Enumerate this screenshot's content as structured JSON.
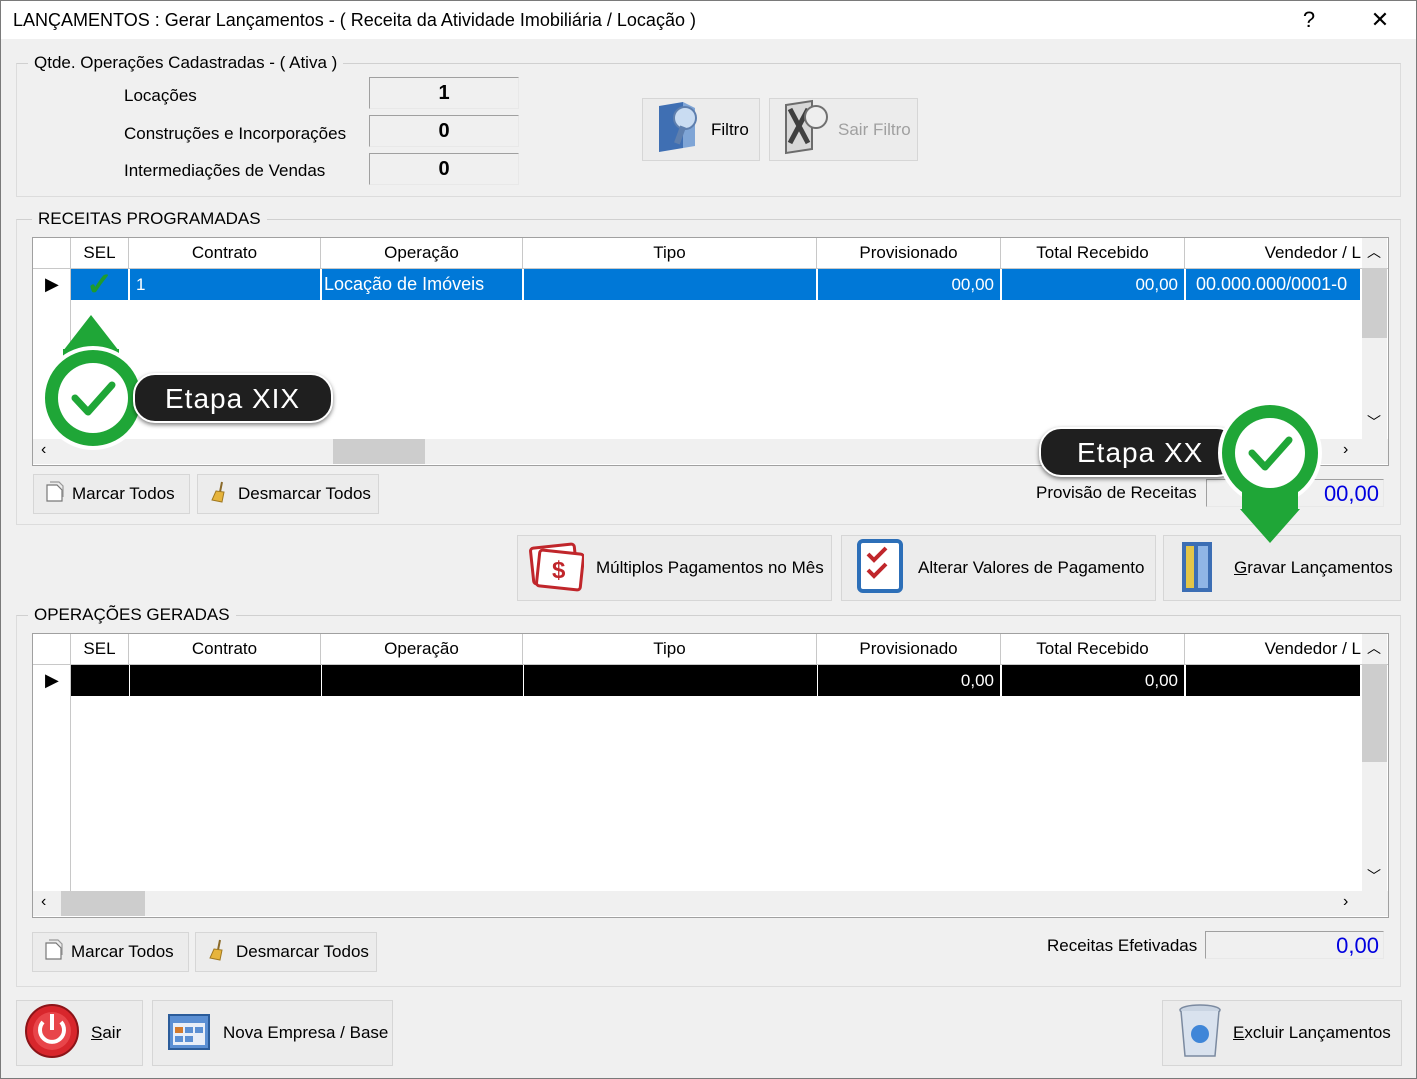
{
  "window": {
    "title": "LANÇAMENTOS : Gerar Lançamentos - ( Receita da Atividade Imobiliária / Locação )",
    "help_label": "?",
    "close_label": "✕"
  },
  "qtde": {
    "legend": "Qtde. Operações Cadastradas - ( Ativa )",
    "rows": [
      {
        "label": "Locações",
        "value": "1"
      },
      {
        "label": "Construções e Incorporações",
        "value": "0"
      },
      {
        "label": "Intermediações de Vendas",
        "value": "0"
      }
    ],
    "filtro_label": "Filtro",
    "sair_filtro_label": "Sair Filtro"
  },
  "receitas": {
    "legend": "RECEITAS PROGRAMADAS",
    "columns": [
      "SEL",
      "Contrato",
      "Operação",
      "Tipo",
      "Provisionado",
      "Total Recebido",
      "Vendedor / L"
    ],
    "row": {
      "indicator": "▶",
      "sel": "✓",
      "contrato": "1",
      "operacao": "Locação de Imóveis",
      "tipo": "",
      "provisionado": "00,00",
      "total_recebido": "00,00",
      "vendedor": "00.000.000/0001-0"
    },
    "marcar_todos": "Marcar Todos",
    "desmarcar_todos": "Desmarcar Todos",
    "total_label": "Provisão de Receitas",
    "total_value": "00,00"
  },
  "actions": {
    "multiplos": "Múltiplos Pagamentos no Mês",
    "alterar": "Alterar Valores de Pagamento",
    "gravar_prefix": "G",
    "gravar_rest": "ravar Lançamentos"
  },
  "operacoes": {
    "legend": "OPERAÇÕES GERADAS",
    "columns": [
      "SEL",
      "Contrato",
      "Operação",
      "Tipo",
      "Provisionado",
      "Total Recebido",
      "Vendedor / L"
    ],
    "row": {
      "indicator": "▶",
      "provisionado": "0,00",
      "total_recebido": "0,00"
    },
    "marcar_todos": "Marcar Todos",
    "desmarcar_todos": "Desmarcar Todos",
    "total_label": "Receitas Efetivadas",
    "total_value": "0,00"
  },
  "footer": {
    "sair_prefix": "S",
    "sair_rest": "air",
    "nova_empresa": "Nova Empresa / Base",
    "excluir_prefix": "E",
    "excluir_rest": "xcluir Lançamentos"
  },
  "annotations": {
    "step1": "Etapa XIX",
    "step2": "Etapa XX",
    "accent_color": "#1fa637"
  },
  "colors": {
    "selection": "#0078d7",
    "total_blue": "#0000e0"
  }
}
